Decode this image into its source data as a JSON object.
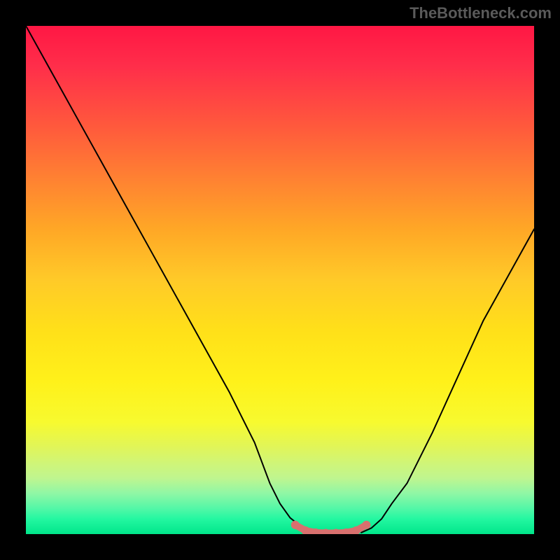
{
  "watermark": "TheBottleneck.com",
  "chart_data": {
    "type": "line",
    "title": "",
    "xlabel": "",
    "ylabel": "",
    "xlim": [
      0,
      100
    ],
    "ylim": [
      0,
      100
    ],
    "series": [
      {
        "name": "left-curve",
        "x": [
          0,
          5,
          10,
          15,
          20,
          25,
          30,
          35,
          40,
          45,
          48,
          50,
          52,
          54,
          56,
          58
        ],
        "y": [
          100,
          91,
          82,
          73,
          64,
          55,
          46,
          37,
          28,
          18,
          10,
          6,
          3.2,
          1.6,
          0.8,
          0.3
        ],
        "color": "#000000"
      },
      {
        "name": "right-curve",
        "x": [
          66,
          68,
          70,
          72,
          75,
          80,
          85,
          90,
          95,
          100
        ],
        "y": [
          0.3,
          1.2,
          3,
          6,
          10,
          20,
          31,
          42,
          51,
          60
        ],
        "color": "#000000"
      },
      {
        "name": "bottom-overlay",
        "x": [
          53,
          55,
          57,
          59,
          61,
          63,
          65,
          67
        ],
        "y": [
          1.8,
          0.7,
          0.3,
          0.2,
          0.2,
          0.3,
          0.7,
          1.8
        ],
        "color": "#d8706e"
      }
    ],
    "gradient_stops": [
      {
        "pos": 0.0,
        "color": "#ff1744"
      },
      {
        "pos": 0.5,
        "color": "#ffca28"
      },
      {
        "pos": 0.8,
        "color": "#f0f83a"
      },
      {
        "pos": 1.0,
        "color": "#00e68a"
      }
    ]
  }
}
